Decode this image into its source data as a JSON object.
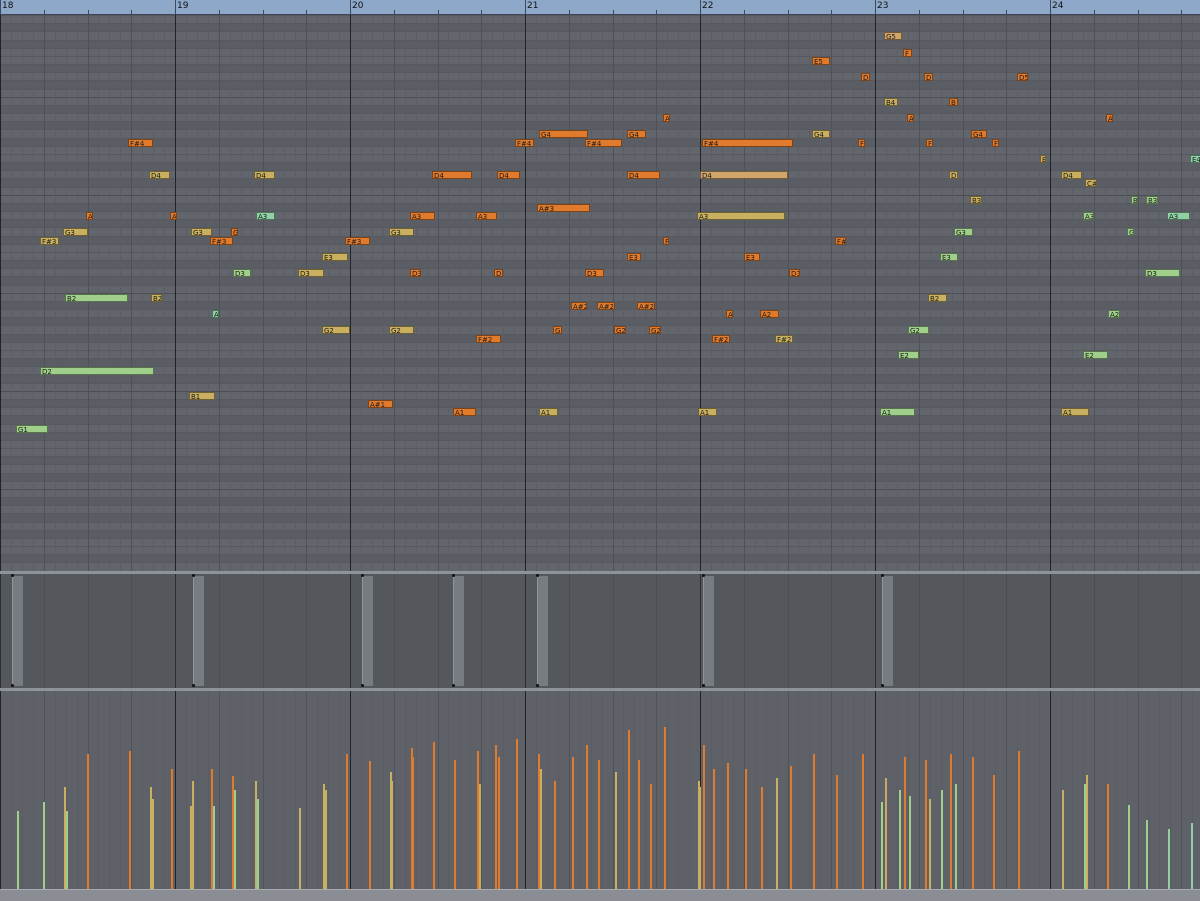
{
  "ruler": {
    "bars": [
      {
        "label": "18",
        "pos": 0
      },
      {
        "label": "19",
        "pos": 1
      },
      {
        "label": "20",
        "pos": 2
      },
      {
        "label": "21",
        "pos": 3
      },
      {
        "label": "22",
        "pos": 4
      },
      {
        "label": "23",
        "pos": 5
      },
      {
        "label": "24",
        "pos": 6
      }
    ]
  },
  "colors": {
    "orange": "#e07a2c",
    "orange_light": "#e8a060",
    "olive": "#c8b060",
    "tan": "#cfa56a",
    "green": "#9fcf8a",
    "mint": "#8fd0a4",
    "grid_bg": "#62666c",
    "ruler_bg": "#8ea8c9"
  },
  "notes": [
    {
      "label": "G5",
      "beat": 5.05,
      "len": 0.1,
      "pitch": 79,
      "c": "tan"
    },
    {
      "label": "F",
      "beat": 5.16,
      "len": 0.05,
      "pitch": 77,
      "c": "orange"
    },
    {
      "label": "E5",
      "beat": 4.64,
      "len": 0.1,
      "pitch": 76,
      "c": "orange"
    },
    {
      "label": "D",
      "beat": 4.92,
      "len": 0.05,
      "pitch": 74,
      "c": "orange"
    },
    {
      "label": "D",
      "beat": 5.28,
      "len": 0.05,
      "pitch": 74,
      "c": "orange"
    },
    {
      "label": "D5",
      "beat": 5.81,
      "len": 0.06,
      "pitch": 74,
      "c": "orange"
    },
    {
      "label": "B4",
      "beat": 5.05,
      "len": 0.08,
      "pitch": 71,
      "c": "olive"
    },
    {
      "label": "B",
      "beat": 5.42,
      "len": 0.05,
      "pitch": 71,
      "c": "orange"
    },
    {
      "label": "A",
      "beat": 3.79,
      "len": 0.04,
      "pitch": 69,
      "c": "orange"
    },
    {
      "label": "A",
      "beat": 5.18,
      "len": 0.04,
      "pitch": 69,
      "c": "orange"
    },
    {
      "label": "A",
      "beat": 6.32,
      "len": 0.04,
      "pitch": 69,
      "c": "orange"
    },
    {
      "label": "F#4",
      "beat": 0.73,
      "len": 0.14,
      "pitch": 66,
      "c": "orange"
    },
    {
      "label": "G4",
      "beat": 3.08,
      "len": 0.28,
      "pitch": 67,
      "c": "orange"
    },
    {
      "label": "G4",
      "beat": 3.58,
      "len": 0.11,
      "pitch": 67,
      "c": "orange"
    },
    {
      "label": "G4",
      "beat": 4.64,
      "len": 0.1,
      "pitch": 67,
      "c": "olive"
    },
    {
      "label": "G4",
      "beat": 5.55,
      "len": 0.09,
      "pitch": 67,
      "c": "orange"
    },
    {
      "label": "F#4",
      "beat": 2.94,
      "len": 0.11,
      "pitch": 66,
      "c": "orange"
    },
    {
      "label": "F#4",
      "beat": 3.34,
      "len": 0.21,
      "pitch": 66,
      "c": "orange"
    },
    {
      "label": "F#4",
      "beat": 4.01,
      "len": 0.52,
      "pitch": 66,
      "c": "orange"
    },
    {
      "label": "F",
      "beat": 4.9,
      "len": 0.04,
      "pitch": 66,
      "c": "orange"
    },
    {
      "label": "F",
      "beat": 5.29,
      "len": 0.04,
      "pitch": 66,
      "c": "orange"
    },
    {
      "label": "F",
      "beat": 5.67,
      "len": 0.04,
      "pitch": 66,
      "c": "orange"
    },
    {
      "label": "E",
      "beat": 5.94,
      "len": 0.03,
      "pitch": 64,
      "c": "olive"
    },
    {
      "label": "E4",
      "beat": 6.8,
      "len": 0.08,
      "pitch": 64,
      "c": "mint"
    },
    {
      "label": "D4",
      "beat": 0.85,
      "len": 0.12,
      "pitch": 62,
      "c": "olive"
    },
    {
      "label": "D4",
      "beat": 1.45,
      "len": 0.12,
      "pitch": 62,
      "c": "olive"
    },
    {
      "label": "D4",
      "beat": 2.47,
      "len": 0.23,
      "pitch": 62,
      "c": "orange"
    },
    {
      "label": "D4",
      "beat": 2.84,
      "len": 0.13,
      "pitch": 62,
      "c": "orange"
    },
    {
      "label": "D4",
      "beat": 3.58,
      "len": 0.19,
      "pitch": 62,
      "c": "orange"
    },
    {
      "label": "D4",
      "beat": 4.0,
      "len": 0.5,
      "pitch": 62,
      "c": "tan"
    },
    {
      "label": "D",
      "beat": 5.42,
      "len": 0.05,
      "pitch": 62,
      "c": "olive"
    },
    {
      "label": "D4",
      "beat": 6.06,
      "len": 0.12,
      "pitch": 62,
      "c": "olive"
    },
    {
      "label": "C#",
      "beat": 6.2,
      "len": 0.07,
      "pitch": 61,
      "c": "olive"
    },
    {
      "label": "B3",
      "beat": 5.54,
      "len": 0.07,
      "pitch": 59,
      "c": "olive"
    },
    {
      "label": "B",
      "beat": 6.46,
      "len": 0.04,
      "pitch": 59,
      "c": "green"
    },
    {
      "label": "B3",
      "beat": 6.55,
      "len": 0.07,
      "pitch": 59,
      "c": "green"
    },
    {
      "label": "A#3",
      "beat": 3.07,
      "len": 0.3,
      "pitch": 58,
      "c": "orange"
    },
    {
      "label": "A",
      "beat": 0.49,
      "len": 0.04,
      "pitch": 57,
      "c": "orange"
    },
    {
      "label": "A",
      "beat": 0.97,
      "len": 0.04,
      "pitch": 57,
      "c": "orange"
    },
    {
      "label": "A3",
      "beat": 1.46,
      "len": 0.11,
      "pitch": 57,
      "c": "mint"
    },
    {
      "label": "A3",
      "beat": 2.34,
      "len": 0.14,
      "pitch": 57,
      "c": "orange"
    },
    {
      "label": "A3",
      "beat": 2.72,
      "len": 0.12,
      "pitch": 57,
      "c": "orange"
    },
    {
      "label": "A3",
      "beat": 3.98,
      "len": 0.5,
      "pitch": 57,
      "c": "olive"
    },
    {
      "label": "A3",
      "beat": 6.19,
      "len": 0.06,
      "pitch": 57,
      "c": "green"
    },
    {
      "label": "A3",
      "beat": 6.67,
      "len": 0.13,
      "pitch": 57,
      "c": "mint"
    },
    {
      "label": "G3",
      "beat": 0.36,
      "len": 0.14,
      "pitch": 55,
      "c": "olive"
    },
    {
      "label": "G3",
      "beat": 1.09,
      "len": 0.12,
      "pitch": 55,
      "c": "olive"
    },
    {
      "label": "G",
      "beat": 1.32,
      "len": 0.04,
      "pitch": 55,
      "c": "orange"
    },
    {
      "label": "G3",
      "beat": 2.22,
      "len": 0.14,
      "pitch": 55,
      "c": "olive"
    },
    {
      "label": "G3",
      "beat": 5.45,
      "len": 0.11,
      "pitch": 55,
      "c": "green"
    },
    {
      "label": "G",
      "beat": 6.44,
      "len": 0.04,
      "pitch": 55,
      "c": "green"
    },
    {
      "label": "F#3",
      "beat": 0.23,
      "len": 0.11,
      "pitch": 54,
      "c": "olive"
    },
    {
      "label": "F#3",
      "beat": 1.2,
      "len": 0.13,
      "pitch": 54,
      "c": "orange"
    },
    {
      "label": "F#3",
      "beat": 1.97,
      "len": 0.14,
      "pitch": 54,
      "c": "orange"
    },
    {
      "label": "F",
      "beat": 3.79,
      "len": 0.03,
      "pitch": 54,
      "c": "orange"
    },
    {
      "label": "F#",
      "beat": 4.77,
      "len": 0.06,
      "pitch": 54,
      "c": "orange"
    },
    {
      "label": "E3",
      "beat": 1.84,
      "len": 0.15,
      "pitch": 52,
      "c": "olive"
    },
    {
      "label": "E3",
      "beat": 3.58,
      "len": 0.08,
      "pitch": 52,
      "c": "orange"
    },
    {
      "label": "E3",
      "beat": 4.25,
      "len": 0.09,
      "pitch": 52,
      "c": "orange"
    },
    {
      "label": "E3",
      "beat": 5.37,
      "len": 0.1,
      "pitch": 52,
      "c": "green"
    },
    {
      "label": "D3",
      "beat": 1.33,
      "len": 0.1,
      "pitch": 50,
      "c": "green"
    },
    {
      "label": "D3",
      "beat": 1.7,
      "len": 0.15,
      "pitch": 50,
      "c": "olive"
    },
    {
      "label": "D3",
      "beat": 2.34,
      "len": 0.06,
      "pitch": 50,
      "c": "orange"
    },
    {
      "label": "D",
      "beat": 2.82,
      "len": 0.05,
      "pitch": 50,
      "c": "orange"
    },
    {
      "label": "D3",
      "beat": 3.34,
      "len": 0.11,
      "pitch": 50,
      "c": "orange"
    },
    {
      "label": "D3",
      "beat": 4.51,
      "len": 0.06,
      "pitch": 50,
      "c": "orange"
    },
    {
      "label": "D3",
      "beat": 6.54,
      "len": 0.2,
      "pitch": 50,
      "c": "green"
    },
    {
      "label": "B2",
      "beat": 0.37,
      "len": 0.36,
      "pitch": 47,
      "c": "green"
    },
    {
      "label": "B2",
      "beat": 0.86,
      "len": 0.06,
      "pitch": 47,
      "c": "olive"
    },
    {
      "label": "B2",
      "beat": 5.3,
      "len": 0.11,
      "pitch": 47,
      "c": "olive"
    },
    {
      "label": "A#2",
      "beat": 3.26,
      "len": 0.09,
      "pitch": 46,
      "c": "orange"
    },
    {
      "label": "A#2",
      "beat": 3.41,
      "len": 0.1,
      "pitch": 46,
      "c": "orange"
    },
    {
      "label": "A#2",
      "beat": 3.64,
      "len": 0.1,
      "pitch": 46,
      "c": "orange"
    },
    {
      "label": "A",
      "beat": 1.21,
      "len": 0.04,
      "pitch": 45,
      "c": "mint"
    },
    {
      "label": "A",
      "beat": 4.15,
      "len": 0.04,
      "pitch": 45,
      "c": "orange"
    },
    {
      "label": "A2",
      "beat": 4.34,
      "len": 0.11,
      "pitch": 45,
      "c": "orange"
    },
    {
      "label": "A2",
      "beat": 6.33,
      "len": 0.07,
      "pitch": 45,
      "c": "green"
    },
    {
      "label": "G2",
      "beat": 1.84,
      "len": 0.16,
      "pitch": 43,
      "c": "olive"
    },
    {
      "label": "G2",
      "beat": 2.22,
      "len": 0.14,
      "pitch": 43,
      "c": "olive"
    },
    {
      "label": "G",
      "beat": 3.16,
      "len": 0.05,
      "pitch": 43,
      "c": "orange"
    },
    {
      "label": "G2",
      "beat": 3.51,
      "len": 0.07,
      "pitch": 43,
      "c": "orange"
    },
    {
      "label": "G2",
      "beat": 3.71,
      "len": 0.07,
      "pitch": 43,
      "c": "orange"
    },
    {
      "label": "G2",
      "beat": 5.19,
      "len": 0.12,
      "pitch": 43,
      "c": "green"
    },
    {
      "label": "F#2",
      "beat": 2.72,
      "len": 0.14,
      "pitch": 42,
      "c": "orange"
    },
    {
      "label": "F#2",
      "beat": 4.07,
      "len": 0.1,
      "pitch": 42,
      "c": "orange"
    },
    {
      "label": "F#2",
      "beat": 4.43,
      "len": 0.1,
      "pitch": 42,
      "c": "olive"
    },
    {
      "label": "E2",
      "beat": 5.13,
      "len": 0.12,
      "pitch": 40,
      "c": "green"
    },
    {
      "label": "E2",
      "beat": 6.19,
      "len": 0.14,
      "pitch": 40,
      "c": "green"
    },
    {
      "label": "D2",
      "beat": 0.23,
      "len": 0.65,
      "pitch": 38,
      "c": "green"
    },
    {
      "label": "B1",
      "beat": 1.08,
      "len": 0.15,
      "pitch": 35,
      "c": "olive"
    },
    {
      "label": "A#1",
      "beat": 2.1,
      "len": 0.14,
      "pitch": 34,
      "c": "orange"
    },
    {
      "label": "A1",
      "beat": 2.59,
      "len": 0.13,
      "pitch": 33,
      "c": "orange"
    },
    {
      "label": "A1",
      "beat": 3.08,
      "len": 0.11,
      "pitch": 33,
      "c": "olive"
    },
    {
      "label": "A1",
      "beat": 3.99,
      "len": 0.11,
      "pitch": 33,
      "c": "olive"
    },
    {
      "label": "A1",
      "beat": 5.03,
      "len": 0.2,
      "pitch": 33,
      "c": "green"
    },
    {
      "label": "A1",
      "beat": 6.06,
      "len": 0.16,
      "pitch": 33,
      "c": "olive"
    },
    {
      "label": "G1",
      "beat": 0.09,
      "len": 0.18,
      "pitch": 31,
      "c": "green"
    }
  ],
  "pedal": [
    0.07,
    1.1,
    2.07,
    2.59,
    3.07,
    4.02,
    5.04
  ],
  "velocity": [
    {
      "beat": 0.09,
      "v": 0.52,
      "c": "green"
    },
    {
      "beat": 0.24,
      "v": 0.58,
      "c": "green"
    },
    {
      "beat": 0.36,
      "v": 0.68,
      "c": "olive"
    },
    {
      "beat": 0.37,
      "v": 0.52,
      "c": "green"
    },
    {
      "beat": 0.49,
      "v": 0.9,
      "c": "orange"
    },
    {
      "beat": 0.73,
      "v": 0.92,
      "c": "orange"
    },
    {
      "beat": 0.85,
      "v": 0.68,
      "c": "olive"
    },
    {
      "beat": 0.86,
      "v": 0.6,
      "c": "olive"
    },
    {
      "beat": 0.97,
      "v": 0.8,
      "c": "orange"
    },
    {
      "beat": 1.08,
      "v": 0.55,
      "c": "olive"
    },
    {
      "beat": 1.09,
      "v": 0.72,
      "c": "olive"
    },
    {
      "beat": 1.2,
      "v": 0.8,
      "c": "orange"
    },
    {
      "beat": 1.21,
      "v": 0.55,
      "c": "mint"
    },
    {
      "beat": 1.32,
      "v": 0.75,
      "c": "orange"
    },
    {
      "beat": 1.33,
      "v": 0.66,
      "c": "green"
    },
    {
      "beat": 1.45,
      "v": 0.72,
      "c": "olive"
    },
    {
      "beat": 1.46,
      "v": 0.6,
      "c": "mint"
    },
    {
      "beat": 1.7,
      "v": 0.54,
      "c": "olive"
    },
    {
      "beat": 1.84,
      "v": 0.7,
      "c": "olive"
    },
    {
      "beat": 1.85,
      "v": 0.66,
      "c": "olive"
    },
    {
      "beat": 1.97,
      "v": 0.9,
      "c": "orange"
    },
    {
      "beat": 2.1,
      "v": 0.85,
      "c": "orange"
    },
    {
      "beat": 2.22,
      "v": 0.78,
      "c": "olive"
    },
    {
      "beat": 2.23,
      "v": 0.72,
      "c": "olive"
    },
    {
      "beat": 2.34,
      "v": 0.94,
      "c": "orange"
    },
    {
      "beat": 2.35,
      "v": 0.88,
      "c": "orange"
    },
    {
      "beat": 2.47,
      "v": 0.98,
      "c": "orange"
    },
    {
      "beat": 2.59,
      "v": 0.86,
      "c": "orange"
    },
    {
      "beat": 2.72,
      "v": 0.92,
      "c": "orange"
    },
    {
      "beat": 2.73,
      "v": 0.7,
      "c": "olive"
    },
    {
      "beat": 2.82,
      "v": 0.96,
      "c": "orange"
    },
    {
      "beat": 2.84,
      "v": 0.88,
      "c": "orange"
    },
    {
      "beat": 2.94,
      "v": 1.0,
      "c": "orange"
    },
    {
      "beat": 3.07,
      "v": 0.9,
      "c": "orange"
    },
    {
      "beat": 3.08,
      "v": 0.8,
      "c": "olive"
    },
    {
      "beat": 3.16,
      "v": 0.72,
      "c": "orange"
    },
    {
      "beat": 3.26,
      "v": 0.88,
      "c": "orange"
    },
    {
      "beat": 3.34,
      "v": 0.96,
      "c": "orange"
    },
    {
      "beat": 3.41,
      "v": 0.86,
      "c": "orange"
    },
    {
      "beat": 3.51,
      "v": 0.78,
      "c": "olive"
    },
    {
      "beat": 3.58,
      "v": 1.06,
      "c": "orange"
    },
    {
      "beat": 3.64,
      "v": 0.86,
      "c": "orange"
    },
    {
      "beat": 3.71,
      "v": 0.7,
      "c": "orange"
    },
    {
      "beat": 3.79,
      "v": 1.08,
      "c": "orange"
    },
    {
      "beat": 3.98,
      "v": 0.72,
      "c": "olive"
    },
    {
      "beat": 3.99,
      "v": 0.68,
      "c": "olive"
    },
    {
      "beat": 4.01,
      "v": 0.96,
      "c": "orange"
    },
    {
      "beat": 4.07,
      "v": 0.8,
      "c": "orange"
    },
    {
      "beat": 4.15,
      "v": 0.84,
      "c": "orange"
    },
    {
      "beat": 4.25,
      "v": 0.8,
      "c": "orange"
    },
    {
      "beat": 4.34,
      "v": 0.68,
      "c": "orange"
    },
    {
      "beat": 4.43,
      "v": 0.74,
      "c": "olive"
    },
    {
      "beat": 4.51,
      "v": 0.82,
      "c": "orange"
    },
    {
      "beat": 4.64,
      "v": 0.9,
      "c": "orange"
    },
    {
      "beat": 4.77,
      "v": 0.76,
      "c": "orange"
    },
    {
      "beat": 4.92,
      "v": 0.9,
      "c": "orange"
    },
    {
      "beat": 5.03,
      "v": 0.58,
      "c": "green"
    },
    {
      "beat": 5.05,
      "v": 0.74,
      "c": "tan"
    },
    {
      "beat": 5.13,
      "v": 0.66,
      "c": "green"
    },
    {
      "beat": 5.16,
      "v": 0.88,
      "c": "orange"
    },
    {
      "beat": 5.19,
      "v": 0.62,
      "c": "green"
    },
    {
      "beat": 5.28,
      "v": 0.86,
      "c": "orange"
    },
    {
      "beat": 5.3,
      "v": 0.6,
      "c": "olive"
    },
    {
      "beat": 5.37,
      "v": 0.66,
      "c": "green"
    },
    {
      "beat": 5.42,
      "v": 0.9,
      "c": "orange"
    },
    {
      "beat": 5.45,
      "v": 0.7,
      "c": "green"
    },
    {
      "beat": 5.55,
      "v": 0.88,
      "c": "orange"
    },
    {
      "beat": 5.67,
      "v": 0.76,
      "c": "orange"
    },
    {
      "beat": 5.81,
      "v": 0.92,
      "c": "orange"
    },
    {
      "beat": 6.06,
      "v": 0.66,
      "c": "olive"
    },
    {
      "beat": 6.19,
      "v": 0.7,
      "c": "green"
    },
    {
      "beat": 6.2,
      "v": 0.76,
      "c": "olive"
    },
    {
      "beat": 6.32,
      "v": 0.7,
      "c": "orange"
    },
    {
      "beat": 6.44,
      "v": 0.56,
      "c": "green"
    },
    {
      "beat": 6.54,
      "v": 0.46,
      "c": "green"
    },
    {
      "beat": 6.67,
      "v": 0.4,
      "c": "mint"
    },
    {
      "beat": 6.8,
      "v": 0.44,
      "c": "mint"
    }
  ]
}
